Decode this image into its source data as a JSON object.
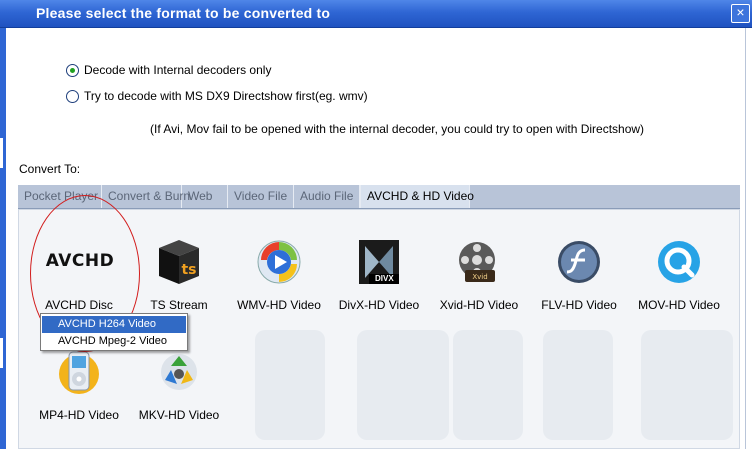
{
  "window": {
    "title": "Please select the format to be converted to",
    "close_glyph": "×"
  },
  "decode_options": [
    {
      "label": "Decode with Internal decoders only",
      "checked": true
    },
    {
      "label": "Try to decode with MS DX9 Directshow first(eg. wmv)",
      "checked": false
    }
  ],
  "hint": "(If Avi, Mov fail to be opened with the internal decoder, you could try to open with Directshow)",
  "convert_to_label": "Convert To:",
  "tabs": [
    {
      "label": "Pocket  Player",
      "active": false
    },
    {
      "label": "Convert & Burn",
      "active": false
    },
    {
      "label": "Web",
      "active": false
    },
    {
      "label": "Video  File",
      "active": false
    },
    {
      "label": "Audio  File",
      "active": false
    },
    {
      "label": "AVCHD & HD Video",
      "active": true
    }
  ],
  "formats": [
    {
      "label": "AVCHD Disc",
      "icon": "avchd-logo-icon"
    },
    {
      "label": "TS Stream",
      "icon": "ts-cube-icon"
    },
    {
      "label": "WMV-HD Video",
      "icon": "windows-media-player-icon"
    },
    {
      "label": "DivX-HD Video",
      "icon": "divx-icon"
    },
    {
      "label": "Xvid-HD Video",
      "icon": "film-reel-icon"
    },
    {
      "label": "FLV-HD Video",
      "icon": "flash-icon"
    },
    {
      "label": "MOV-HD Video",
      "icon": "quicktime-icon"
    },
    {
      "label": "MP4-HD Video",
      "icon": "ipod-icon"
    },
    {
      "label": "MKV-HD Video",
      "icon": "recycle-icon"
    }
  ],
  "avchd_logo_text": "AVCHD",
  "divx_badge_text": "DIVX",
  "context_menu": [
    {
      "label": "AVCHD H264 Video",
      "selected": true
    },
    {
      "label": "AVCHD Mpeg-2 Video",
      "selected": false
    }
  ],
  "colors": {
    "titlebar": "#2f66d4",
    "highlight": "#316ac5",
    "annotation_circle": "#d21d1d"
  }
}
